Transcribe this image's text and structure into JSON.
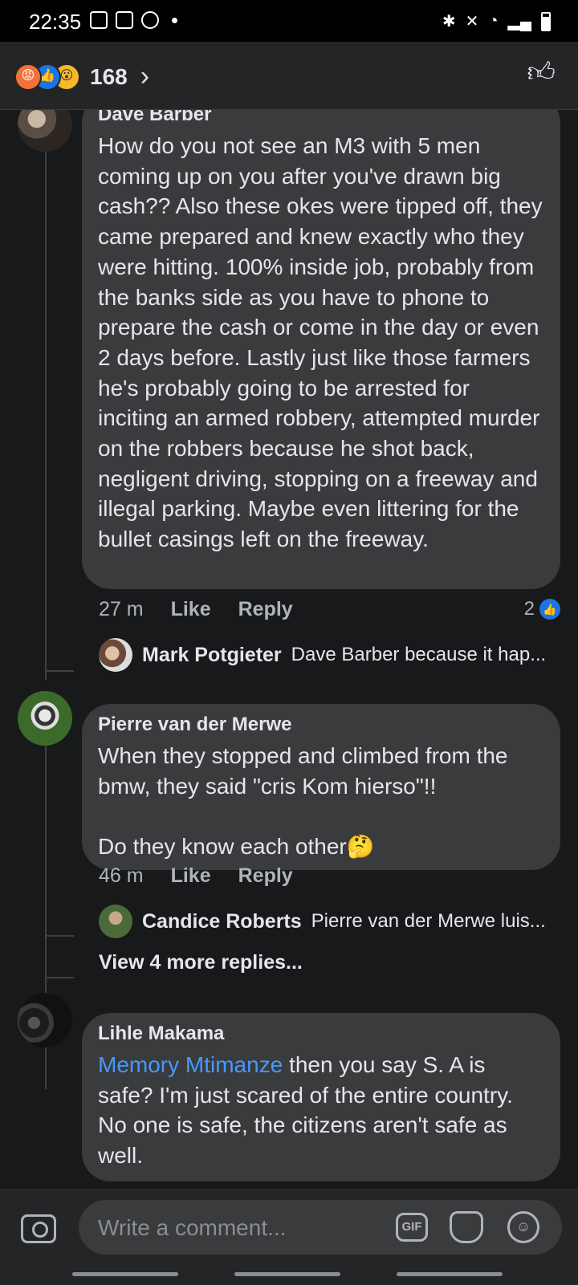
{
  "status_bar": {
    "time": "22:35"
  },
  "header": {
    "reaction_count": "168"
  },
  "comments": [
    {
      "author": "Dave Barber",
      "text": "How do you not see an M3 with 5 men coming up on you after you've drawn big cash?? Also these okes were tipped off, they came prepared and knew exactly who they were hitting. 100% inside job, probably from the banks side as you have to phone to prepare the cash or come in the day or even 2 days before. Lastly just like those farmers he's probably going to be arrested for inciting an armed robbery, attempted murder on the robbers because he shot back, negligent driving, stopping on a freeway and illegal parking. Maybe even littering for the bullet casings left on the freeway.",
      "time": "27 m",
      "like_label": "Like",
      "reply_label": "Reply",
      "reaction_count": "2",
      "reply": {
        "author": "Mark Potgieter",
        "text": "Dave Barber because it hap..."
      }
    },
    {
      "author": "Pierre van der Merwe",
      "text": "When they stopped and climbed from the bmw, they said \"cris Kom hierso\"!!\n\nDo they know each other🤔",
      "time": "46 m",
      "like_label": "Like",
      "reply_label": "Reply",
      "reply": {
        "author": "Candice Roberts",
        "text": "Pierre van der Merwe luis..."
      },
      "more_replies": "View 4 more replies..."
    },
    {
      "author": "Lihle Makama",
      "mention": "Memory Mtimanze",
      "text": " then you say S. A is safe? I'm just scared of the entire country. No one is safe, the citizens aren't safe as well."
    }
  ],
  "composer": {
    "placeholder": "Write a comment...",
    "gif_label": "GIF"
  }
}
